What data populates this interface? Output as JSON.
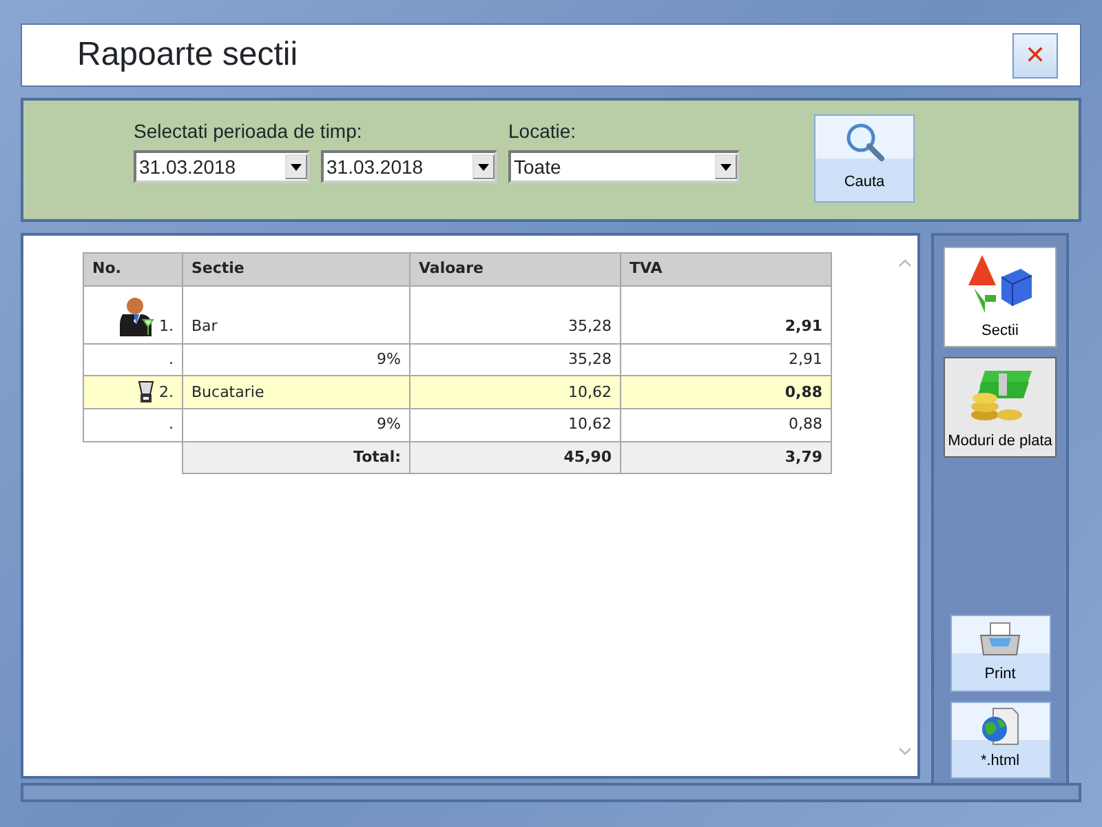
{
  "window": {
    "title": "Rapoarte sectii",
    "close": "✕"
  },
  "filters": {
    "period_label": "Selectati perioada de timp:",
    "date_from": "31.03.2018",
    "date_to": "31.03.2018",
    "location_label": "Locatie:",
    "location": "Toate",
    "search_button": "Cauta"
  },
  "table": {
    "columns": [
      "No.",
      "Sectie",
      "Valoare",
      "TVA"
    ],
    "rows": [
      {
        "kind": "section",
        "no": "1.",
        "name": "Bar",
        "value": "35,28",
        "tva": "2,91",
        "selected": false
      },
      {
        "kind": "rate",
        "no": ".",
        "name": "9%",
        "value": "35,28",
        "tva": "2,91"
      },
      {
        "kind": "section",
        "no": "2.",
        "name": "Bucatarie",
        "value": "10,62",
        "tva": "0,88",
        "selected": true
      },
      {
        "kind": "rate",
        "no": ".",
        "name": "9%",
        "value": "10,62",
        "tva": "0,88"
      },
      {
        "kind": "total",
        "name": "Total:",
        "value": "45,90",
        "tva": "3,79"
      }
    ]
  },
  "side_buttons": [
    {
      "label": "Sectii",
      "selected": true
    },
    {
      "label": "Moduri de plata",
      "selected": false
    }
  ],
  "export_buttons": [
    "Print",
    "*.html"
  ]
}
